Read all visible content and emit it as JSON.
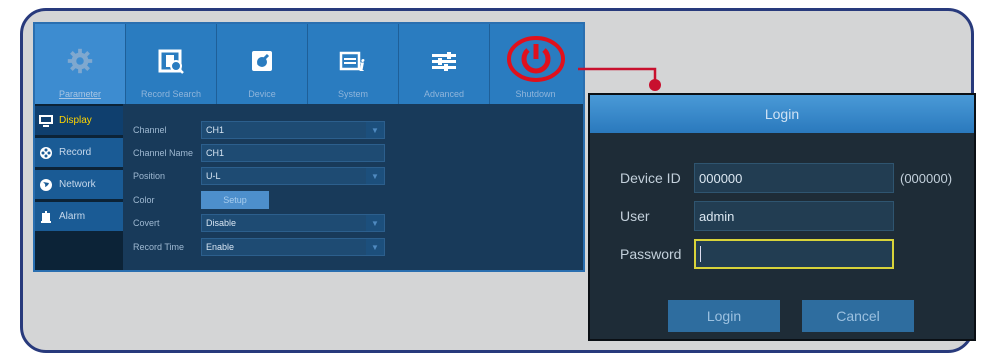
{
  "tabs": [
    {
      "label": "Parameter",
      "icon": "gear-icon"
    },
    {
      "label": "Record Search",
      "icon": "film-search-icon"
    },
    {
      "label": "Device",
      "icon": "device-icon"
    },
    {
      "label": "System",
      "icon": "system-info-icon"
    },
    {
      "label": "Advanced",
      "icon": "sliders-icon"
    },
    {
      "label": "Shutdown",
      "icon": "power-icon"
    }
  ],
  "sidebar": {
    "items": [
      {
        "label": "Display",
        "icon": "monitor-icon"
      },
      {
        "label": "Record",
        "icon": "film-reel-icon"
      },
      {
        "label": "Network",
        "icon": "globe-icon"
      },
      {
        "label": "Alarm",
        "icon": "alarm-icon"
      }
    ]
  },
  "display_settings": {
    "channel_label": "Channel",
    "channel_value": "CH1",
    "channel_name_label": "Channel Name",
    "channel_name_value": "CH1",
    "position_label": "Position",
    "position_value": "U-L",
    "color_label": "Color",
    "setup_label": "Setup",
    "covert_label": "Covert",
    "covert_value": "Disable",
    "record_time_label": "Record Time",
    "record_time_value": "Enable"
  },
  "login": {
    "title": "Login",
    "device_id_label": "Device ID",
    "device_id_value": "000000",
    "device_id_hint": "(000000)",
    "user_label": "User",
    "user_value": "admin",
    "password_label": "Password",
    "password_value": "",
    "login_button": "Login",
    "cancel_button": "Cancel"
  },
  "colors": {
    "frame_border": "#283a7c",
    "tab_bar": "#2a7cc0",
    "highlight_circle": "#e0101c",
    "connector": "#c8102e",
    "active_sidebar_text": "#ffd400",
    "password_focus": "#d8d33a"
  }
}
